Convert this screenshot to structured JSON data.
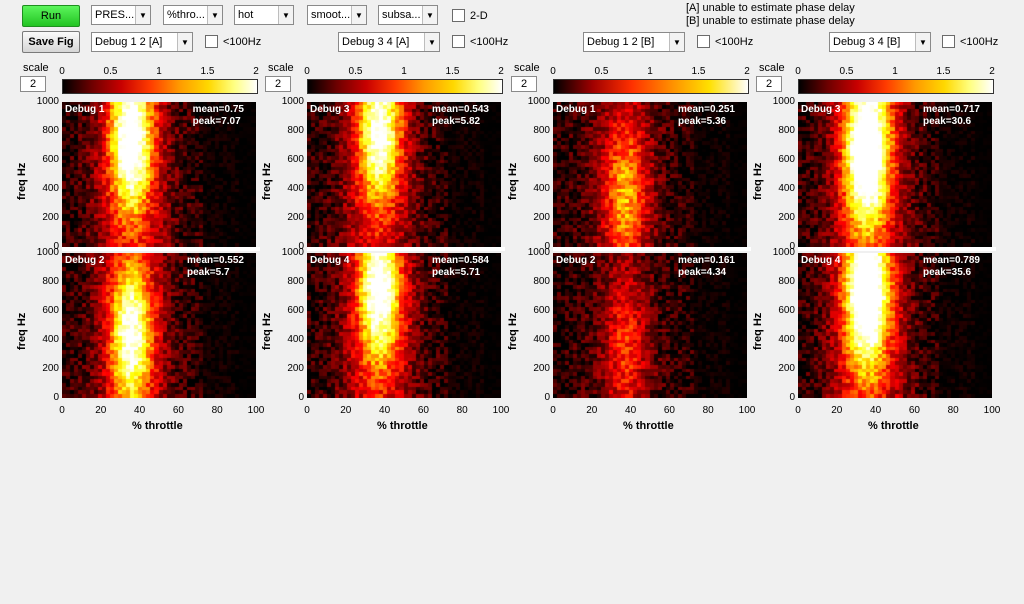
{
  "toolbar": {
    "run_label": "Run",
    "save_label": "Save Fig",
    "dropdowns": [
      "PRES...",
      "%thro...",
      "hot",
      "smoot...",
      "subsa..."
    ],
    "twod_label": "2-D",
    "notes": [
      "[A] unable to estimate phase delay",
      "[B] unable to estimate phase delay"
    ]
  },
  "selectors": [
    {
      "value": "Debug 1 2 [A]",
      "check": "<100Hz"
    },
    {
      "value": "Debug 3 4 [A]",
      "check": "<100Hz"
    },
    {
      "value": "Debug 1 2 [B]",
      "check": "<100Hz"
    },
    {
      "value": "Debug 3 4 [B]",
      "check": "<100Hz"
    }
  ],
  "scale_label": "scale",
  "scale_value": "2",
  "colorbar_ticks": [
    "0",
    "0.5",
    "1",
    "1.5",
    "2"
  ],
  "y_ticks": [
    "1000",
    "800",
    "600",
    "400",
    "200",
    "0"
  ],
  "x_ticks": [
    "0",
    "20",
    "40",
    "60",
    "80",
    "100"
  ],
  "ylabel": "freq Hz",
  "xlabel": "% throttle",
  "panels": [
    {
      "title": "Debug 1",
      "mean": "mean=0.75",
      "peak": "peak=7.07",
      "hot_x": 0.35,
      "hot_y": 0.75,
      "intensity": 0.85
    },
    {
      "title": "Debug 2",
      "mean": "mean=0.552",
      "peak": "peak=5.7",
      "hot_x": 0.35,
      "hot_y": 0.45,
      "intensity": 0.75
    },
    {
      "title": "Debug 3",
      "mean": "mean=0.543",
      "peak": "peak=5.82",
      "hot_x": 0.37,
      "hot_y": 0.8,
      "intensity": 0.75
    },
    {
      "title": "Debug 4",
      "mean": "mean=0.584",
      "peak": "peak=5.71",
      "hot_x": 0.37,
      "hot_y": 0.75,
      "intensity": 0.8
    },
    {
      "title": "Debug 1",
      "mean": "mean=0.251",
      "peak": "peak=5.36",
      "hot_x": 0.37,
      "hot_y": 0.38,
      "intensity": 0.45
    },
    {
      "title": "Debug 2",
      "mean": "mean=0.161",
      "peak": "peak=4.34",
      "hot_x": 0.37,
      "hot_y": 0.35,
      "intensity": 0.3
    },
    {
      "title": "Debug 3",
      "mean": "mean=0.717",
      "peak": "peak=30.6",
      "hot_x": 0.35,
      "hot_y": 0.67,
      "intensity": 1.0
    },
    {
      "title": "Debug 4",
      "mean": "mean=0.789",
      "peak": "peak=35.6",
      "hot_x": 0.35,
      "hot_y": 0.75,
      "intensity": 1.0
    }
  ]
}
